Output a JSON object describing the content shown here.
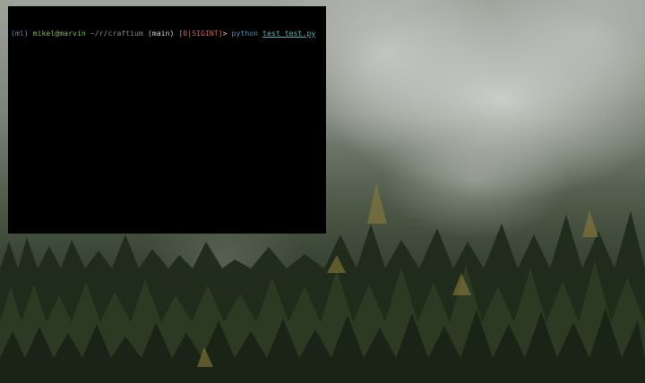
{
  "terminal": {
    "prompt": {
      "env": "(ml)",
      "user_host": "mikel@marvin",
      "path": "~/r/craftium",
      "branch": "(main)",
      "status": "[0|SIGINT]",
      "arrow": ">",
      "command": "python",
      "argument": "test_test.py"
    }
  },
  "colors": {
    "terminal_bg": "#000000",
    "env": "#5f87af",
    "user": "#87af5f",
    "status": "#d75f3f",
    "command": "#5f87af",
    "argument": "#5fafaf"
  }
}
